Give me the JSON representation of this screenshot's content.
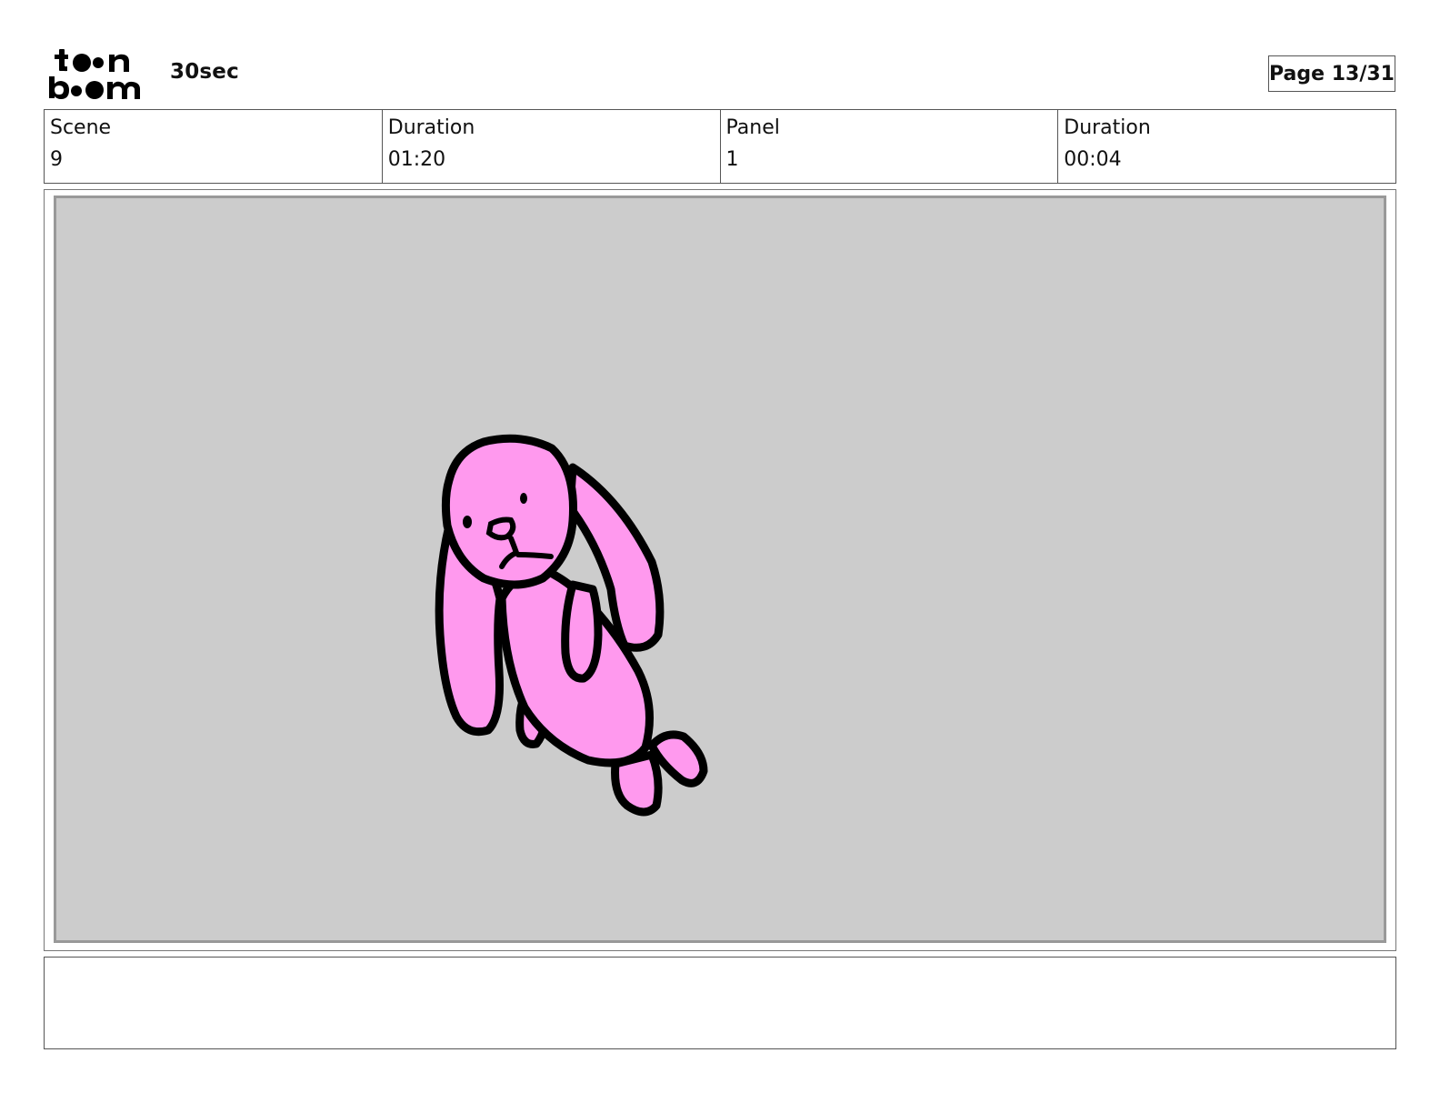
{
  "header": {
    "logo_icon": "toon-boom-logo-icon",
    "logo_text_top": "toon",
    "logo_text_bottom": "boom",
    "project_title": "30sec",
    "page_label": "Page 13/31"
  },
  "info": {
    "scene_label": "Scene",
    "scene_value": "9",
    "scene_duration_label": "Duration",
    "scene_duration_value": "01:20",
    "panel_label": "Panel",
    "panel_value": "1",
    "panel_duration_label": "Duration",
    "panel_duration_value": "00:04"
  },
  "panel": {
    "background_color": "#cccccc",
    "character_icon": "pink-bunny-plush-drawing",
    "character_fill": "#ff99ee",
    "outline_color": "#000000"
  },
  "notes": {
    "text": ""
  }
}
